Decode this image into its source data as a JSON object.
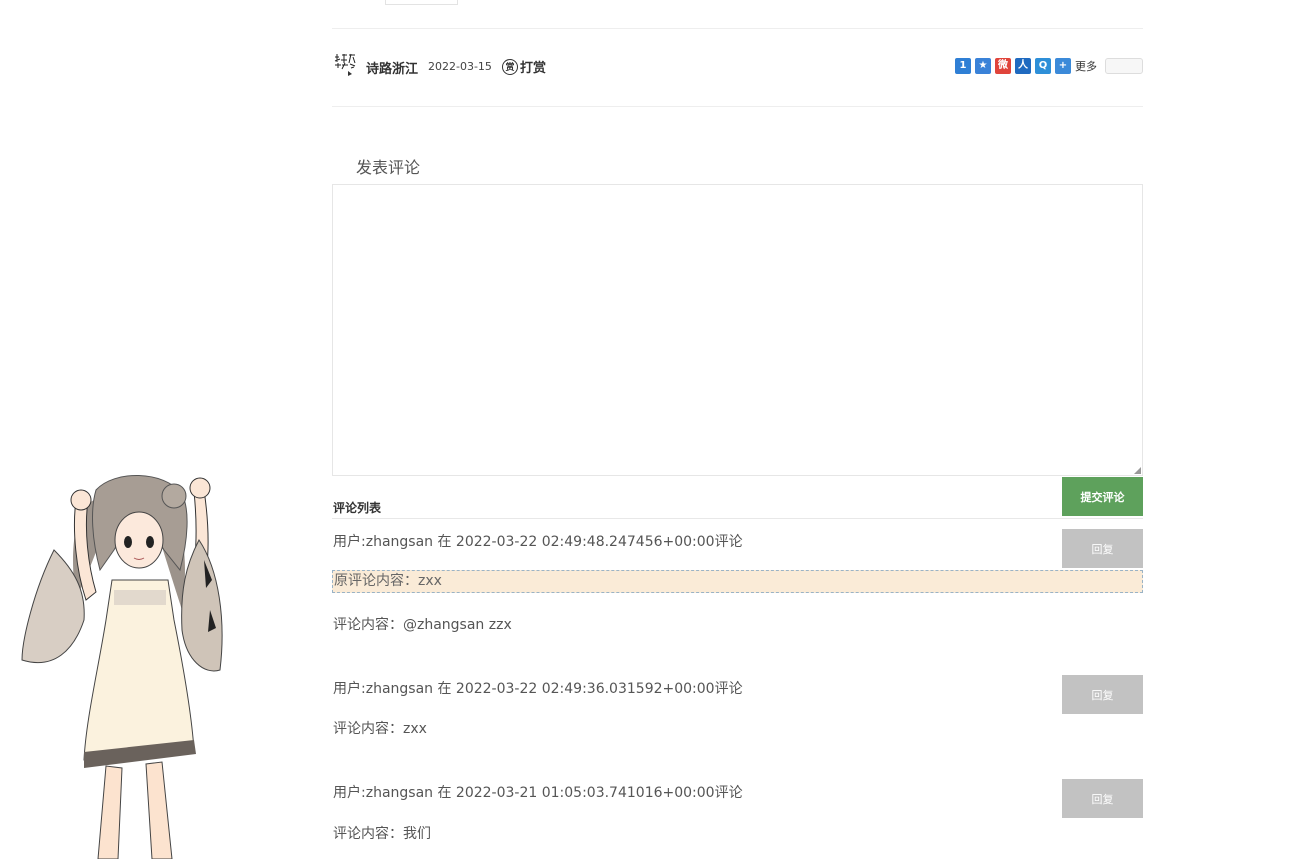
{
  "article_footer": {
    "author": "诗路浙江",
    "date": "2022-03-15",
    "reward_icon": "赏",
    "reward_label": "打赏",
    "share_icons": [
      {
        "name": "share-qzone-icon",
        "color": "#2f7fd5",
        "glyph": "1"
      },
      {
        "name": "share-favorite-icon",
        "color": "#3a82d8",
        "glyph": "★"
      },
      {
        "name": "share-weibo-icon",
        "color": "#e0443b",
        "glyph": "微"
      },
      {
        "name": "share-renren-icon",
        "color": "#1f6ac0",
        "glyph": "人"
      },
      {
        "name": "share-tqq-icon",
        "color": "#2e8fd8",
        "glyph": "Q"
      },
      {
        "name": "share-more-icon",
        "color": "#3b8ad9",
        "glyph": "+"
      }
    ],
    "share_more_label": "更多"
  },
  "comment_form": {
    "heading": "发表评论",
    "textarea_value": "",
    "submit_label": "提交评论"
  },
  "comment_list": {
    "title": "评论列表",
    "reply_label": "回复",
    "comments": [
      {
        "meta": "用户:zhangsan 在 2022-03-22 02:49:48.247456+00:00评论",
        "quote": "原评论内容：zxx",
        "body": "评论内容：@zhangsan zzx"
      },
      {
        "meta": "用户:zhangsan 在 2022-03-22 02:49:36.031592+00:00评论",
        "body": "评论内容：zxx"
      },
      {
        "meta": "用户:zhangsan 在 2022-03-21 01:05:03.741016+00:00评论",
        "body": "评论内容：我们"
      }
    ]
  },
  "colors": {
    "submit_green": "#5ea15c",
    "reply_gray": "#c2c2c2",
    "quote_background": "#faebd7"
  }
}
